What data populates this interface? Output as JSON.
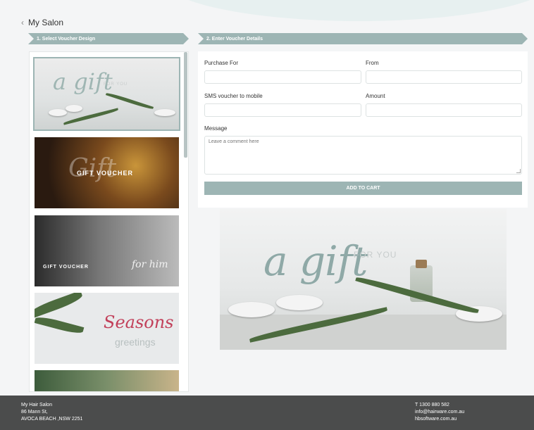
{
  "breadcrumb": {
    "back_icon": "chevron-left-icon",
    "title": "My Salon"
  },
  "steps": {
    "step1": "1. Select Voucher Design",
    "step2": "2. Enter Voucher Details"
  },
  "vouchers": [
    {
      "script": "a gift",
      "label": "FOR YOU",
      "selected": true
    },
    {
      "script": "Gift",
      "label": "GIFT VOUCHER",
      "selected": false
    },
    {
      "script": "for him",
      "label": "GIFT VOUCHER",
      "selected": false
    },
    {
      "script": "Seasons",
      "label": "greetings",
      "selected": false
    }
  ],
  "form": {
    "purchase_for_label": "Purchase For",
    "from_label": "From",
    "sms_label": "SMS voucher to mobile",
    "amount_label": "Amount",
    "message_label": "Message",
    "message_placeholder": "Leave a comment here",
    "add_to_cart": "ADD TO CART"
  },
  "preview": {
    "script": "a gift",
    "sub": "FOR YOU"
  },
  "footer": {
    "name": "My Hair Salon",
    "street": "86 Mann St,",
    "city": "AVOCA BEACH ,NSW 2251",
    "phone": "T 1300 880 582",
    "email": "info@hairware.com.au",
    "website": "hbsoftware.com.au"
  },
  "colors": {
    "accent": "#9db5b4",
    "footer": "#4b4c4c"
  }
}
